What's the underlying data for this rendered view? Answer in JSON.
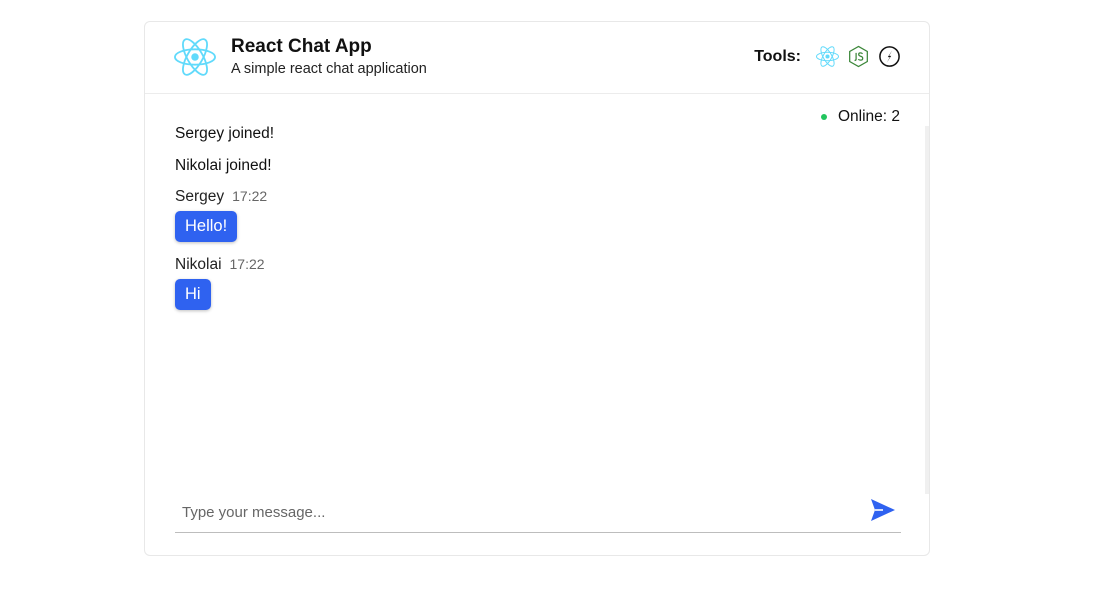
{
  "header": {
    "title": "React Chat App",
    "subtitle": "A simple react chat application",
    "logo_icon": "react-logo-icon",
    "tools_label": "Tools:",
    "tools": [
      {
        "name": "react-icon",
        "color": "#61dafb"
      },
      {
        "name": "nodejs-icon",
        "color": "#3c873a"
      },
      {
        "name": "socketio-icon",
        "color": "#111111"
      }
    ]
  },
  "status": {
    "online_text": "Online: 2",
    "dot_color": "#22c55e"
  },
  "messages": {
    "system": [
      "Sergey joined!",
      "Nikolai joined!"
    ],
    "chat": [
      {
        "author": "Sergey",
        "time": "17:22",
        "text": "Hello!"
      },
      {
        "author": "Nikolai",
        "time": "17:22",
        "text": "Hi"
      }
    ]
  },
  "composer": {
    "placeholder": "Type your message...",
    "value": "",
    "send_icon": "send-icon"
  },
  "colors": {
    "accent": "#2f62f0",
    "react": "#61dafb"
  }
}
